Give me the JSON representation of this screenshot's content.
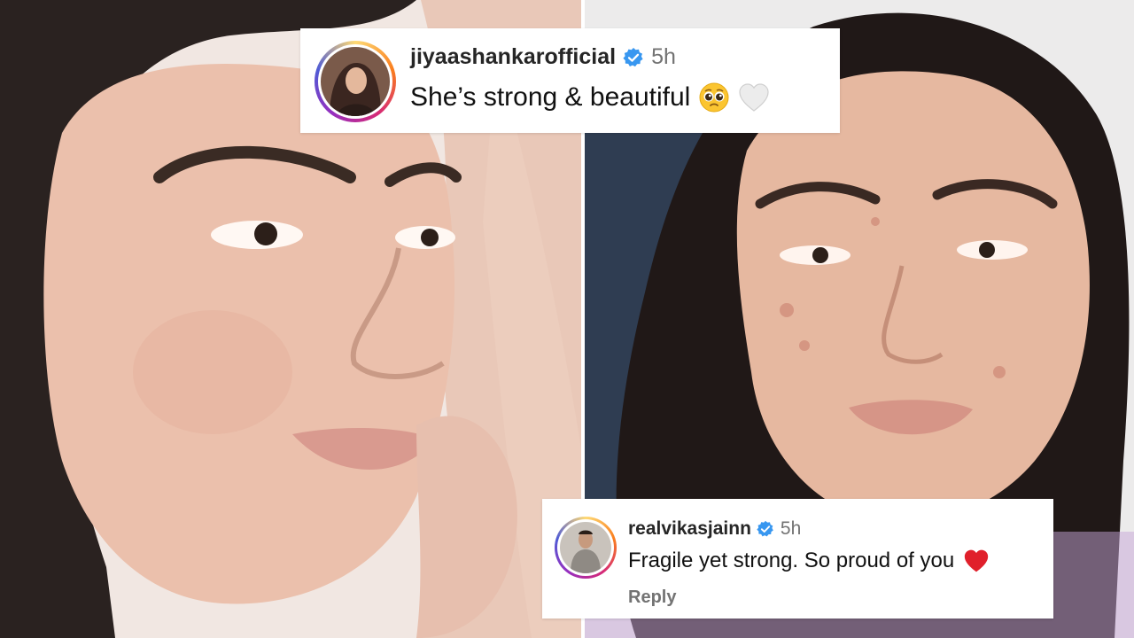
{
  "comments": [
    {
      "username": "jiyaashankarofficial",
      "verified": true,
      "time": "5h",
      "text": "She’s strong & beautiful",
      "emojis": [
        "pleading-face-icon",
        "white-heart-icon"
      ]
    },
    {
      "username": "realvikasjainn",
      "verified": true,
      "time": "5h",
      "text": "Fragile yet strong. So proud of you",
      "emojis": [
        "red-heart-icon"
      ],
      "reply_label": "Reply"
    }
  ],
  "colors": {
    "verified": "#3897f0",
    "username": "#262626",
    "meta": "#737373",
    "heart_red": "#e0202b",
    "heart_white": "#e8e8e8",
    "card_bg": "#ffffff"
  }
}
